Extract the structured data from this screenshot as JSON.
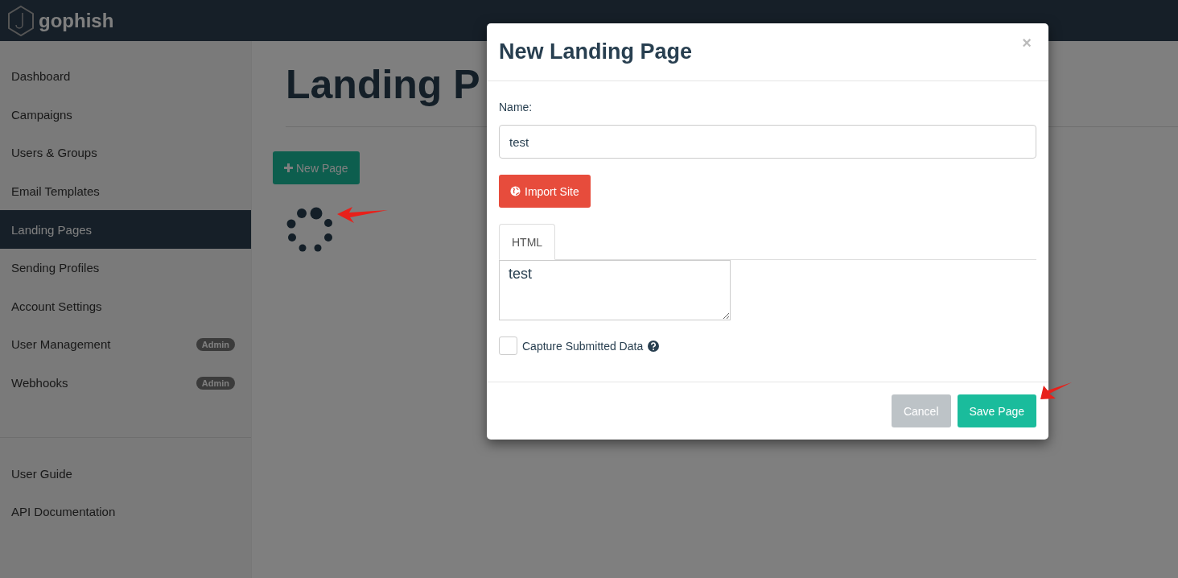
{
  "brand": {
    "name": "gophish"
  },
  "sidebar": {
    "items": [
      {
        "label": "Dashboard",
        "selected": false
      },
      {
        "label": "Campaigns",
        "selected": false
      },
      {
        "label": "Users & Groups",
        "selected": false
      },
      {
        "label": "Email Templates",
        "selected": false
      },
      {
        "label": "Landing Pages",
        "selected": true
      },
      {
        "label": "Sending Profiles",
        "selected": false
      },
      {
        "label": "Account Settings",
        "selected": false
      },
      {
        "label": "User Management",
        "selected": false,
        "badge": "Admin"
      },
      {
        "label": "Webhooks",
        "selected": false,
        "badge": "Admin"
      }
    ],
    "links": [
      {
        "label": "User Guide"
      },
      {
        "label": "API Documentation"
      }
    ]
  },
  "page": {
    "title": "Landing P",
    "new_button": "New Page"
  },
  "modal": {
    "title": "New Landing Page",
    "close": "×",
    "name_label": "Name:",
    "name_value": "test",
    "import_button": "Import Site",
    "tabs": [
      {
        "label": "HTML",
        "selected": true
      }
    ],
    "html_value": "test",
    "capture": {
      "label": "Capture Submitted Data",
      "checked": false
    },
    "buttons": [
      {
        "label": "Cancel",
        "kind": "cancel"
      },
      {
        "label": "Save Page",
        "kind": "primary"
      }
    ]
  }
}
